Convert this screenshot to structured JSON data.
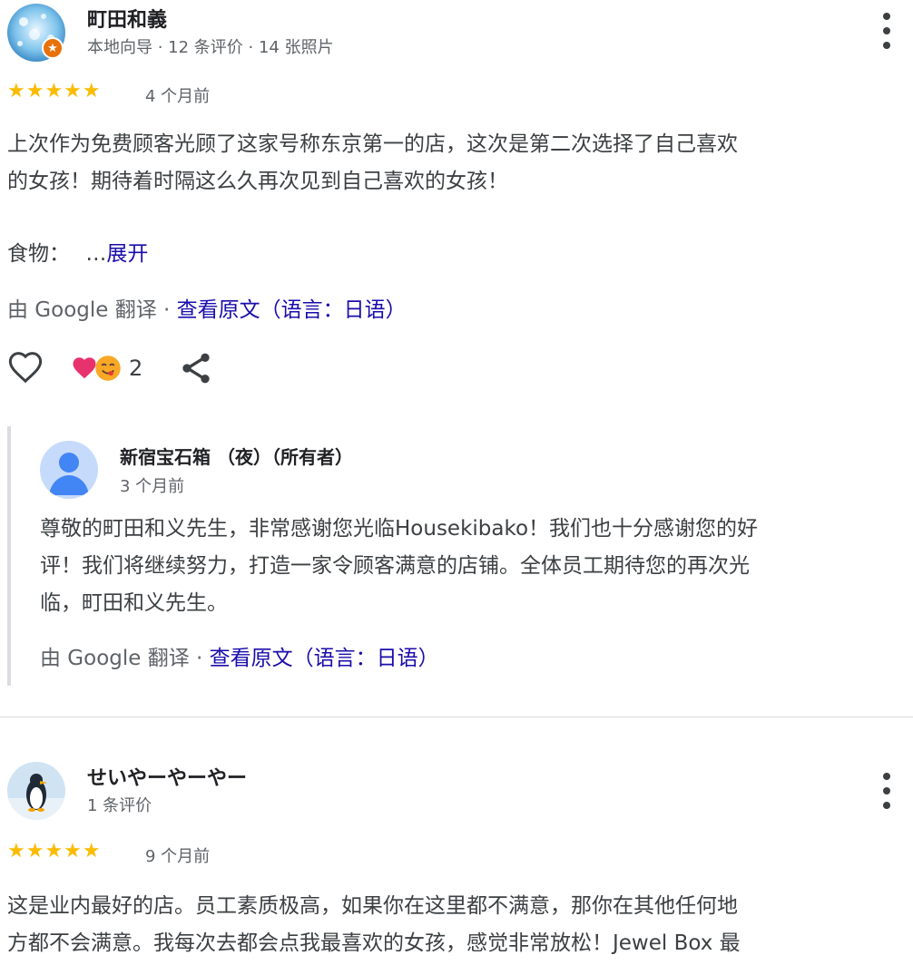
{
  "review1": {
    "author": "町田和義",
    "meta": "本地向导 · 12 条评价 · 14 张照片",
    "stars": "★★★★★",
    "date": "4 个月前",
    "text_line1": "上次作为免费顾客光顾了这家号称东京第一的店，这次是第二次选择了自己喜欢",
    "text_line2": "的女孩！期待着时隔这么久再次见到自己喜欢的女孩！",
    "food_label": "食物：",
    "ellipsis": "…",
    "expand": "展开",
    "translated_by": "由 Google 翻译 ·",
    "view_original": "查看原文（语言：日语）",
    "reaction_count": "2"
  },
  "reply": {
    "author": "新宿宝石箱 （夜）（所有者）",
    "date": "3 个月前",
    "line1": "尊敬的町田和义先生，非常感谢您光临Housekibako！我们也十分感谢您的好",
    "line2": "评！我们将继续努力，打造一家令顾客满意的店铺。全体员工期待您的再次光",
    "line3": "临，町田和义先生。",
    "translated_by": "由 Google 翻译 ·",
    "view_original": "查看原文（语言：日语）"
  },
  "review2": {
    "author": "せいやーやーやー",
    "meta": "1 条评价",
    "stars": "★★★★★",
    "date": "9 个月前",
    "text_line1": "这是业内最好的店。员工素质极高，如果你在这里都不满意，那你在其他任何地",
    "text_line2": "方都不会满意。我每次去都会点我最喜欢的女孩，感觉非常放松！Jewel Box 最"
  },
  "colors": {
    "star": "#fbbc04",
    "link": "#1a0dab",
    "badge": "#e8710a"
  }
}
